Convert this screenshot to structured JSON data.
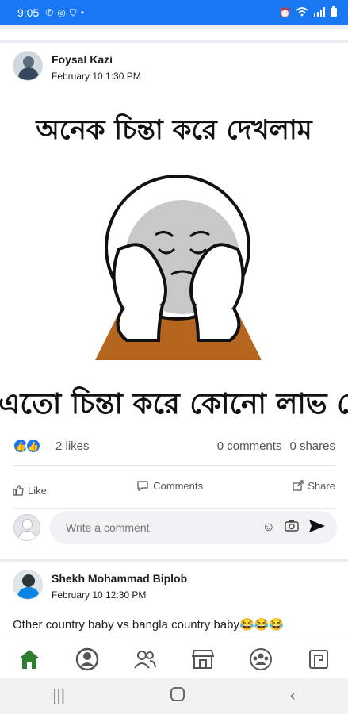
{
  "status_bar": {
    "time": "9:05"
  },
  "post1": {
    "author": "Foysal Kazi",
    "timestamp": "February 10 1:30 PM",
    "meme_top_text": "অনেক চিন্তা করে দেখলাম",
    "meme_bottom_text": "এতো চিন্তা করে কোনো লাভ নেই",
    "likes": "2 likes",
    "comments": "0 comments",
    "shares": "0 shares",
    "actions": {
      "like": "Like",
      "comments": "Comments",
      "share": "Share"
    },
    "comment_placeholder": "Write a comment"
  },
  "post2": {
    "author": "Shekh Mohammad Biplob",
    "timestamp": "February 10 12:30 PM",
    "text": "Other country baby vs bangla country baby😂😂😂"
  },
  "bottom_nav": [
    "home-icon",
    "profile-icon",
    "friends-icon",
    "marketplace-icon",
    "groups-icon",
    "pages-icon"
  ],
  "colors": {
    "brand": "#1877f2",
    "active_nav": "#2e7d32"
  }
}
